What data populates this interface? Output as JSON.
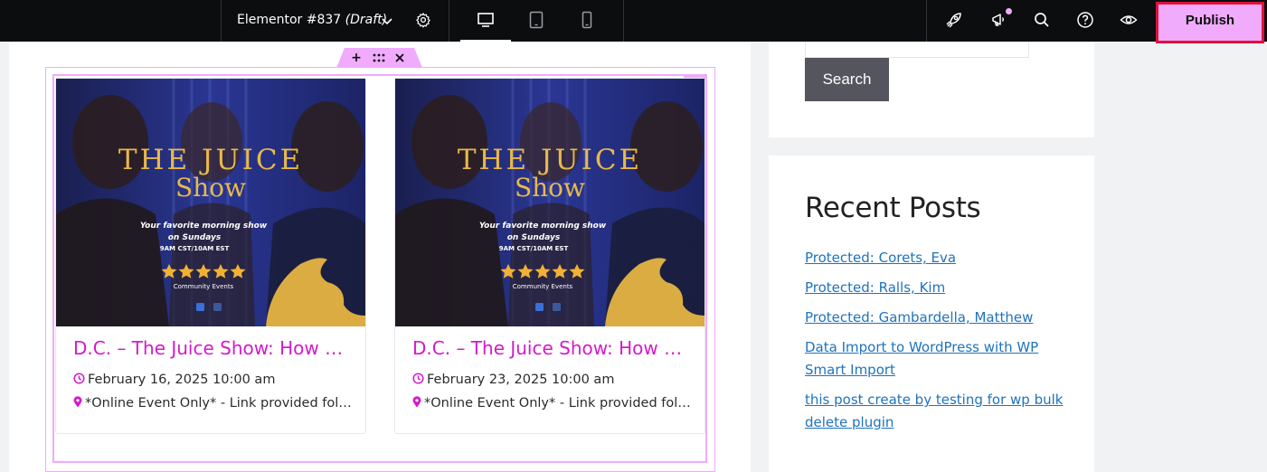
{
  "topbar": {
    "document_name": "Elementor #837",
    "document_status": "(Draft)",
    "publish_label": "Publish",
    "accent_color": "#f0abfc",
    "devices": [
      "desktop",
      "tablet",
      "mobile"
    ],
    "active_device": "desktop"
  },
  "section_controls": [
    "add-icon",
    "drag-handle-icon",
    "close-icon"
  ],
  "events": [
    {
      "title": "D.C. – The Juice Show: How to Start a Business",
      "date": "February 16, 2025 10:00 am",
      "location": "*Online Event Only* - Link provided following registration",
      "image": {
        "title_line1": "THE JUICE",
        "title_line2": "Show",
        "tagline1": "Your favorite morning show",
        "tagline2": "on Sundays",
        "time": "9AM CST/10AM EST",
        "rating_stars": 5,
        "caption": "Community Events"
      }
    },
    {
      "title": "D.C. – The Juice Show: How to Build Wealth",
      "date": "February 23, 2025 10:00 am",
      "location": "*Online Event Only* - Link provided following registration",
      "image": {
        "title_line1": "THE JUICE",
        "title_line2": "Show",
        "tagline1": "Your favorite morning show",
        "tagline2": "on Sundays",
        "time": "9AM CST/10AM EST",
        "rating_stars": 5,
        "caption": "Community Events"
      }
    }
  ],
  "sidebar": {
    "search_button": "Search",
    "recent_posts_title": "Recent Posts",
    "recent_posts": [
      "Protected: Corets, Eva",
      "Protected: Ralls, Kim",
      "Protected: Gambardella, Matthew",
      "Data Import to WordPress with WP Smart Import",
      "this post create by testing for wp bulk delete plugin"
    ],
    "link_color": "#1e73be"
  }
}
